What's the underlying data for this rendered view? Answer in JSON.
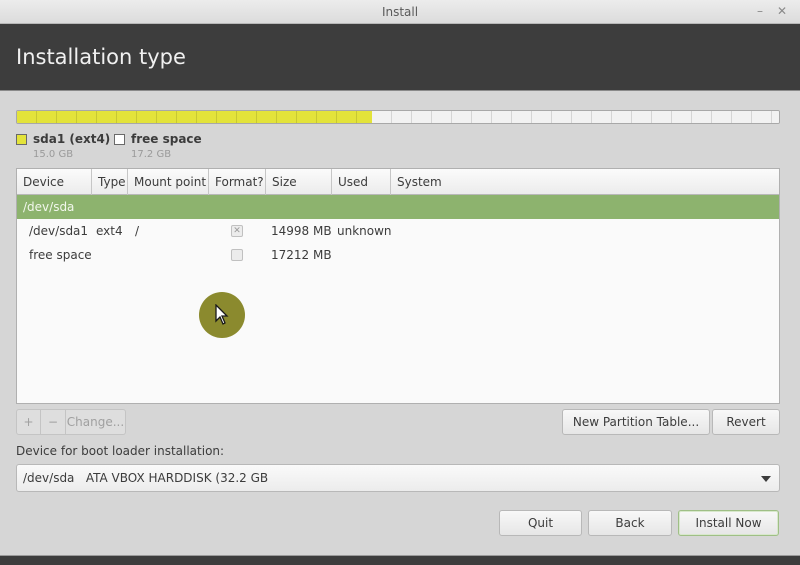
{
  "window": {
    "title": "Install",
    "minimize_icon": "minimize-icon",
    "close_icon": "close-icon"
  },
  "header": {
    "title": "Installation type"
  },
  "partition_bar": {
    "used_fraction": 0.466,
    "colors": {
      "used": "#e3e33a",
      "free": "#f2f2f2"
    }
  },
  "legend": [
    {
      "name": "sda1 (ext4)",
      "size": "15.0 GB",
      "color": "#e3e33a"
    },
    {
      "name": "free space",
      "size": "17.2 GB",
      "color": "#ffffff"
    }
  ],
  "table": {
    "columns": [
      "Device",
      "Type",
      "Mount point",
      "Format?",
      "Size",
      "Used",
      "System"
    ],
    "group": "/dev/sda",
    "group_color": "#8db36e",
    "rows": [
      {
        "device": "/dev/sda1",
        "type": "ext4",
        "mount": "/",
        "format": true,
        "format_disabled": true,
        "size": "14998 MB",
        "used": "unknown",
        "system": ""
      },
      {
        "device": "free space",
        "type": "",
        "mount": "",
        "format": false,
        "format_disabled": true,
        "size": "17212 MB",
        "used": "",
        "system": ""
      }
    ]
  },
  "toolbar": {
    "add_label": "+",
    "remove_label": "−",
    "change_label": "Change...",
    "new_partition_table_label": "New Partition Table...",
    "revert_label": "Revert"
  },
  "bootloader": {
    "label": "Device for boot loader installation:",
    "selected": "/dev/sda   ATA VBOX HARDDISK (32.2 GB"
  },
  "footer": {
    "quit_label": "Quit",
    "back_label": "Back",
    "install_label": "Install Now"
  }
}
